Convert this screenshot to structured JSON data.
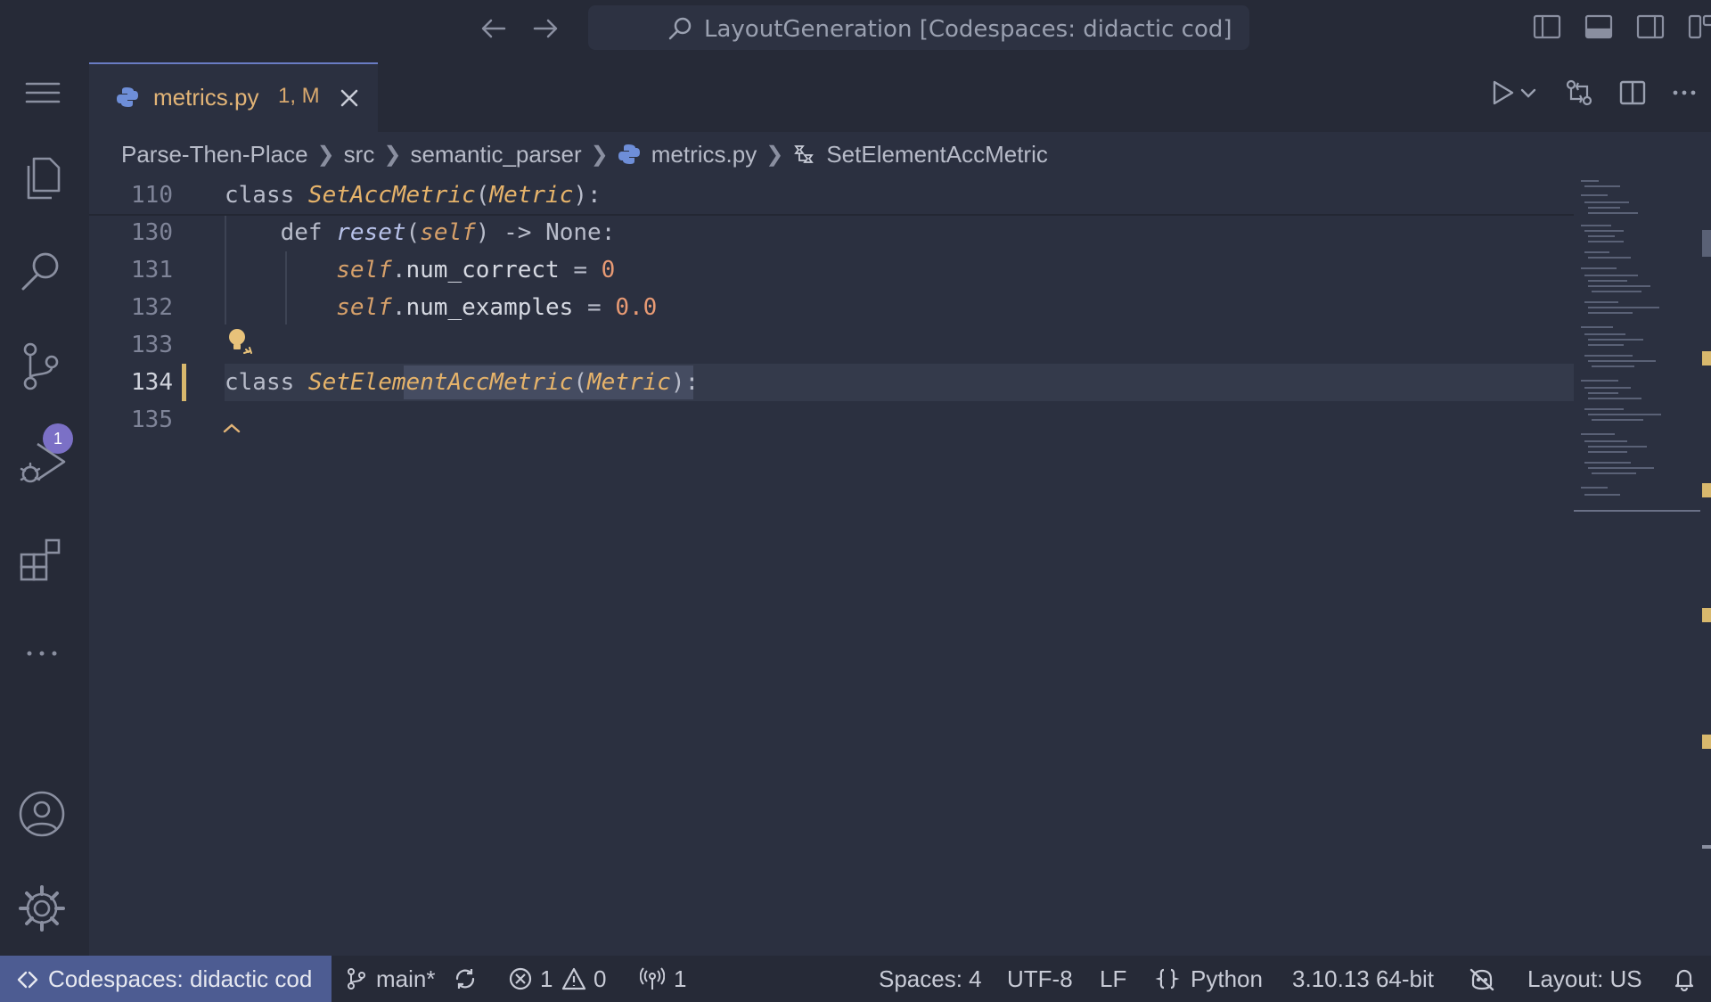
{
  "titlebar": {
    "command_center_text": "LayoutGeneration [Codespaces: didactic cod]"
  },
  "activity_bar": {
    "scm_badge": "1"
  },
  "tab": {
    "file_name": "metrics.py",
    "status": "1, M"
  },
  "breadcrumb": {
    "items": [
      "Parse-Then-Place",
      "src",
      "semantic_parser",
      "metrics.py",
      "SetElementAccMetric"
    ]
  },
  "editor": {
    "lines": [
      {
        "number": "110",
        "tokens": [
          [
            "kw",
            "class "
          ],
          [
            "cls",
            "SetAccMetric"
          ],
          [
            "pun",
            "("
          ],
          [
            "cls",
            "Metric"
          ],
          [
            "pun",
            "):"
          ]
        ]
      },
      {
        "number": "130",
        "tokens": [
          [
            "kw",
            "    def "
          ],
          [
            "fn",
            "reset"
          ],
          [
            "pun",
            "("
          ],
          [
            "self",
            "self"
          ],
          [
            "pun",
            ") -> "
          ],
          [
            "kw",
            "None"
          ],
          [
            "pun",
            ":"
          ]
        ]
      },
      {
        "number": "131",
        "tokens": [
          [
            "self",
            "        self"
          ],
          [
            "pun",
            "."
          ],
          [
            "ident",
            "num_correct"
          ],
          [
            "pun",
            " = "
          ],
          [
            "num",
            "0"
          ]
        ]
      },
      {
        "number": "132",
        "tokens": [
          [
            "self",
            "        self"
          ],
          [
            "pun",
            "."
          ],
          [
            "ident",
            "num_examples"
          ],
          [
            "pun",
            " = "
          ],
          [
            "num",
            "0.0"
          ]
        ]
      },
      {
        "number": "133",
        "tokens": []
      },
      {
        "number": "134",
        "tokens": [
          [
            "kw",
            "class "
          ],
          [
            "cls",
            "SetElementAccMetric"
          ],
          [
            "pun",
            "("
          ],
          [
            "cls",
            "Metric"
          ],
          [
            "pun",
            "):"
          ]
        ]
      },
      {
        "number": "135",
        "tokens": []
      }
    ]
  },
  "status_bar": {
    "remote": "Codespaces: didactic cod",
    "branch": "main*",
    "errors": "1",
    "warnings": "0",
    "ports": "1",
    "spaces": "Spaces: 4",
    "encoding": "UTF-8",
    "eol": "LF",
    "language": "Python",
    "interpreter": "3.10.13 64-bit",
    "keyboard_layout": "Layout: US"
  },
  "colors": {
    "accent": "#4d5c92",
    "modified": "#d8b86d",
    "background": "#2b3040"
  }
}
